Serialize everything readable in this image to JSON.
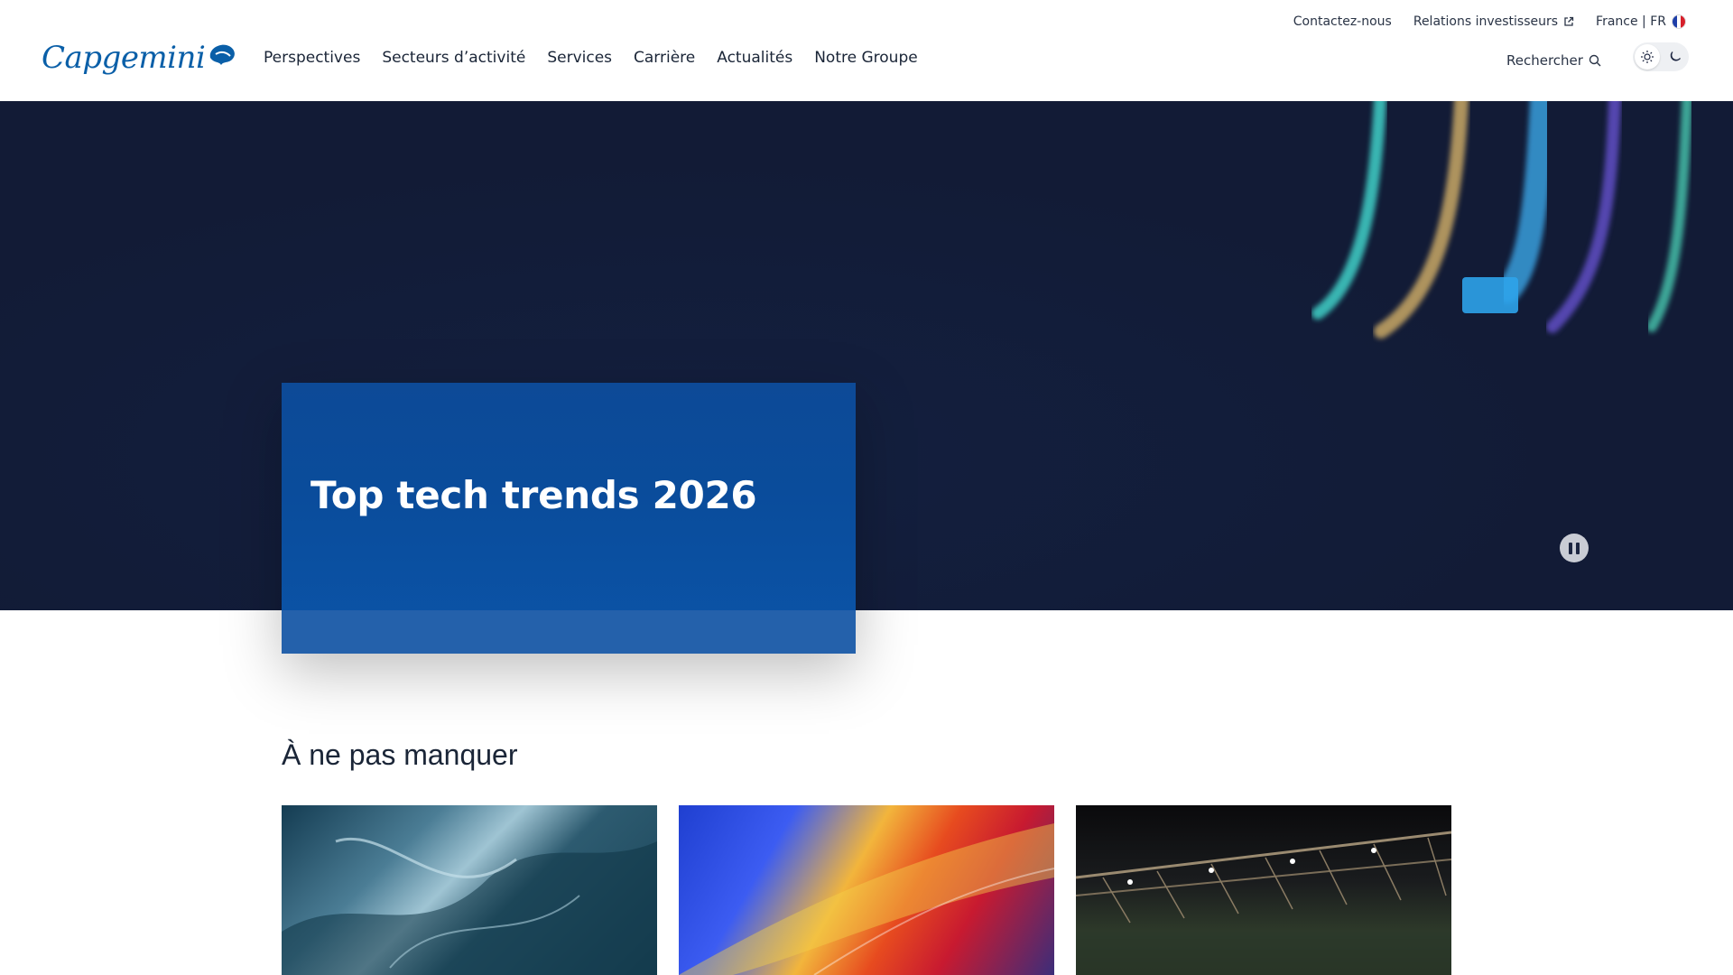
{
  "header": {
    "logo": "Capgemini",
    "nav": [
      "Perspectives",
      "Secteurs d’activité",
      "Services",
      "Carrière",
      "Actualités",
      "Notre Groupe"
    ],
    "utility": {
      "contact": "Contactez-nous",
      "investors": "Relations investisseurs",
      "locale": "France | FR"
    },
    "search_label": "Rechercher",
    "theme": {
      "light_icon": "sun-icon",
      "dark_icon": "moon-icon",
      "active": "light"
    }
  },
  "hero": {
    "card_title": "Top tech trends 2026",
    "pause_icon": "pause-icon"
  },
  "section": {
    "title": "À ne pas manquer"
  },
  "colors": {
    "brand": "#0a5fa8",
    "hero_bg": "#121b36",
    "card_bg": "#0a4c9b"
  }
}
